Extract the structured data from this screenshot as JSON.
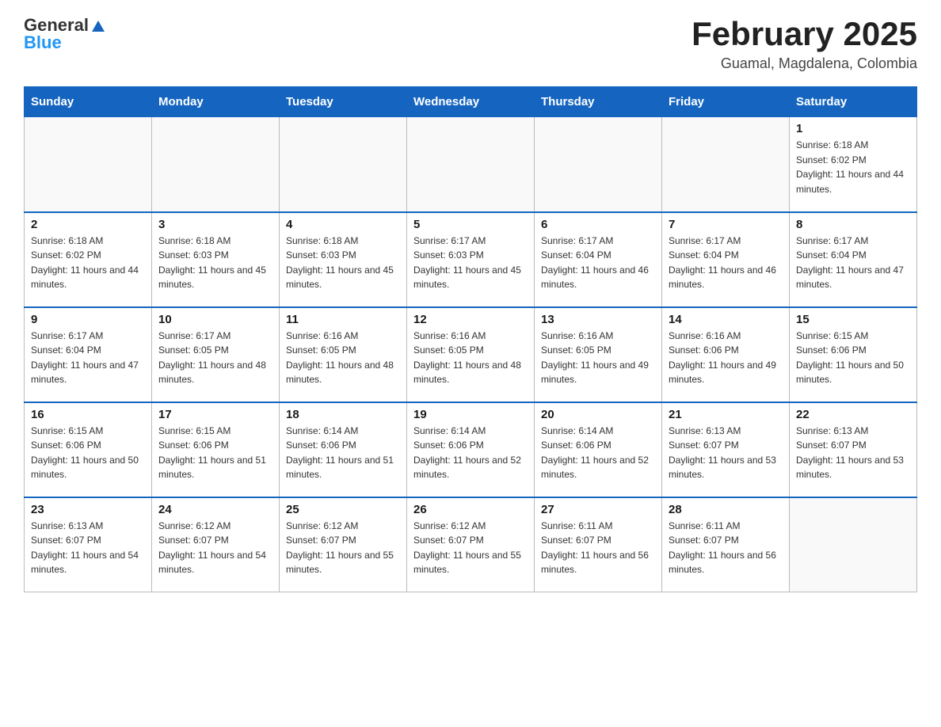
{
  "header": {
    "logo_general": "General",
    "logo_blue": "Blue",
    "month_title": "February 2025",
    "location": "Guamal, Magdalena, Colombia"
  },
  "days_of_week": [
    "Sunday",
    "Monday",
    "Tuesday",
    "Wednesday",
    "Thursday",
    "Friday",
    "Saturday"
  ],
  "weeks": [
    [
      {
        "day": "",
        "info": ""
      },
      {
        "day": "",
        "info": ""
      },
      {
        "day": "",
        "info": ""
      },
      {
        "day": "",
        "info": ""
      },
      {
        "day": "",
        "info": ""
      },
      {
        "day": "",
        "info": ""
      },
      {
        "day": "1",
        "info": "Sunrise: 6:18 AM\nSunset: 6:02 PM\nDaylight: 11 hours and 44 minutes."
      }
    ],
    [
      {
        "day": "2",
        "info": "Sunrise: 6:18 AM\nSunset: 6:02 PM\nDaylight: 11 hours and 44 minutes."
      },
      {
        "day": "3",
        "info": "Sunrise: 6:18 AM\nSunset: 6:03 PM\nDaylight: 11 hours and 45 minutes."
      },
      {
        "day": "4",
        "info": "Sunrise: 6:18 AM\nSunset: 6:03 PM\nDaylight: 11 hours and 45 minutes."
      },
      {
        "day": "5",
        "info": "Sunrise: 6:17 AM\nSunset: 6:03 PM\nDaylight: 11 hours and 45 minutes."
      },
      {
        "day": "6",
        "info": "Sunrise: 6:17 AM\nSunset: 6:04 PM\nDaylight: 11 hours and 46 minutes."
      },
      {
        "day": "7",
        "info": "Sunrise: 6:17 AM\nSunset: 6:04 PM\nDaylight: 11 hours and 46 minutes."
      },
      {
        "day": "8",
        "info": "Sunrise: 6:17 AM\nSunset: 6:04 PM\nDaylight: 11 hours and 47 minutes."
      }
    ],
    [
      {
        "day": "9",
        "info": "Sunrise: 6:17 AM\nSunset: 6:04 PM\nDaylight: 11 hours and 47 minutes."
      },
      {
        "day": "10",
        "info": "Sunrise: 6:17 AM\nSunset: 6:05 PM\nDaylight: 11 hours and 48 minutes."
      },
      {
        "day": "11",
        "info": "Sunrise: 6:16 AM\nSunset: 6:05 PM\nDaylight: 11 hours and 48 minutes."
      },
      {
        "day": "12",
        "info": "Sunrise: 6:16 AM\nSunset: 6:05 PM\nDaylight: 11 hours and 48 minutes."
      },
      {
        "day": "13",
        "info": "Sunrise: 6:16 AM\nSunset: 6:05 PM\nDaylight: 11 hours and 49 minutes."
      },
      {
        "day": "14",
        "info": "Sunrise: 6:16 AM\nSunset: 6:06 PM\nDaylight: 11 hours and 49 minutes."
      },
      {
        "day": "15",
        "info": "Sunrise: 6:15 AM\nSunset: 6:06 PM\nDaylight: 11 hours and 50 minutes."
      }
    ],
    [
      {
        "day": "16",
        "info": "Sunrise: 6:15 AM\nSunset: 6:06 PM\nDaylight: 11 hours and 50 minutes."
      },
      {
        "day": "17",
        "info": "Sunrise: 6:15 AM\nSunset: 6:06 PM\nDaylight: 11 hours and 51 minutes."
      },
      {
        "day": "18",
        "info": "Sunrise: 6:14 AM\nSunset: 6:06 PM\nDaylight: 11 hours and 51 minutes."
      },
      {
        "day": "19",
        "info": "Sunrise: 6:14 AM\nSunset: 6:06 PM\nDaylight: 11 hours and 52 minutes."
      },
      {
        "day": "20",
        "info": "Sunrise: 6:14 AM\nSunset: 6:06 PM\nDaylight: 11 hours and 52 minutes."
      },
      {
        "day": "21",
        "info": "Sunrise: 6:13 AM\nSunset: 6:07 PM\nDaylight: 11 hours and 53 minutes."
      },
      {
        "day": "22",
        "info": "Sunrise: 6:13 AM\nSunset: 6:07 PM\nDaylight: 11 hours and 53 minutes."
      }
    ],
    [
      {
        "day": "23",
        "info": "Sunrise: 6:13 AM\nSunset: 6:07 PM\nDaylight: 11 hours and 54 minutes."
      },
      {
        "day": "24",
        "info": "Sunrise: 6:12 AM\nSunset: 6:07 PM\nDaylight: 11 hours and 54 minutes."
      },
      {
        "day": "25",
        "info": "Sunrise: 6:12 AM\nSunset: 6:07 PM\nDaylight: 11 hours and 55 minutes."
      },
      {
        "day": "26",
        "info": "Sunrise: 6:12 AM\nSunset: 6:07 PM\nDaylight: 11 hours and 55 minutes."
      },
      {
        "day": "27",
        "info": "Sunrise: 6:11 AM\nSunset: 6:07 PM\nDaylight: 11 hours and 56 minutes."
      },
      {
        "day": "28",
        "info": "Sunrise: 6:11 AM\nSunset: 6:07 PM\nDaylight: 11 hours and 56 minutes."
      },
      {
        "day": "",
        "info": ""
      }
    ]
  ]
}
